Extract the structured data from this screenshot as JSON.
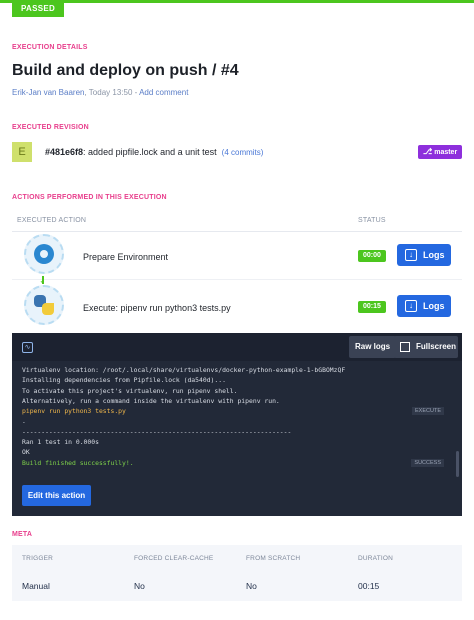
{
  "status_badge": "PASSED",
  "sections": {
    "execution_details": "EXECUTION DETAILS",
    "executed_revision": "EXECUTED REVISION",
    "actions": "ACTIONS PERFORMED IN THIS EXECUTION",
    "meta": "META"
  },
  "execution": {
    "title": "Build and deploy on push / #4",
    "author": "Erik-Jan van Baaren",
    "time": "Today 13:50",
    "add_comment": "Add comment"
  },
  "revision": {
    "avatar_letter": "E",
    "hash": "#481e6f8",
    "message": ": added pipfile.lock and a unit test",
    "commits": "(4 commits)",
    "branch": "master"
  },
  "actions_table": {
    "col_action": "EXECUTED ACTION",
    "col_status": "STATUS",
    "rows": [
      {
        "name": "Prepare Environment",
        "duration": "00:00",
        "logs_label": "Logs",
        "icon": "gear-icon"
      },
      {
        "name": "Execute: pipenv run python3 tests.py",
        "duration": "00:15",
        "logs_label": "Logs",
        "icon": "python-icon"
      }
    ]
  },
  "log_panel": {
    "raw_label": "Raw logs",
    "fullscreen_label": "Fullscreen",
    "lines": [
      "Virtualenv location: /root/.local/share/virtualenvs/docker-python-example-1-bGBOMzQF",
      "Installing dependencies from Pipfile.lock (da540d)...",
      "To activate this project's virtualenv, run pipenv shell.",
      "Alternatively, run a command inside the virtualenv with pipenv run.",
      "pipenv run python3 tests.py",
      ".",
      "----------------------------------------------------------------------",
      "Ran 1 test in 0.000s",
      "OK",
      "Build finished successfully!."
    ],
    "tag_execute": "EXECUTE",
    "tag_success": "SUCCESS",
    "edit_label": "Edit this action"
  },
  "meta": {
    "headers": [
      "TRIGGER",
      "FORCED CLEAR-CACHE",
      "FROM SCRATCH",
      "DURATION"
    ],
    "values": [
      "Manual",
      "No",
      "No",
      "00:15"
    ]
  },
  "colors": {
    "accent_green": "#4cc61e",
    "section_pink": "#e83e8c",
    "primary_blue": "#2468e0",
    "branch_purple": "#8e2fdc"
  }
}
